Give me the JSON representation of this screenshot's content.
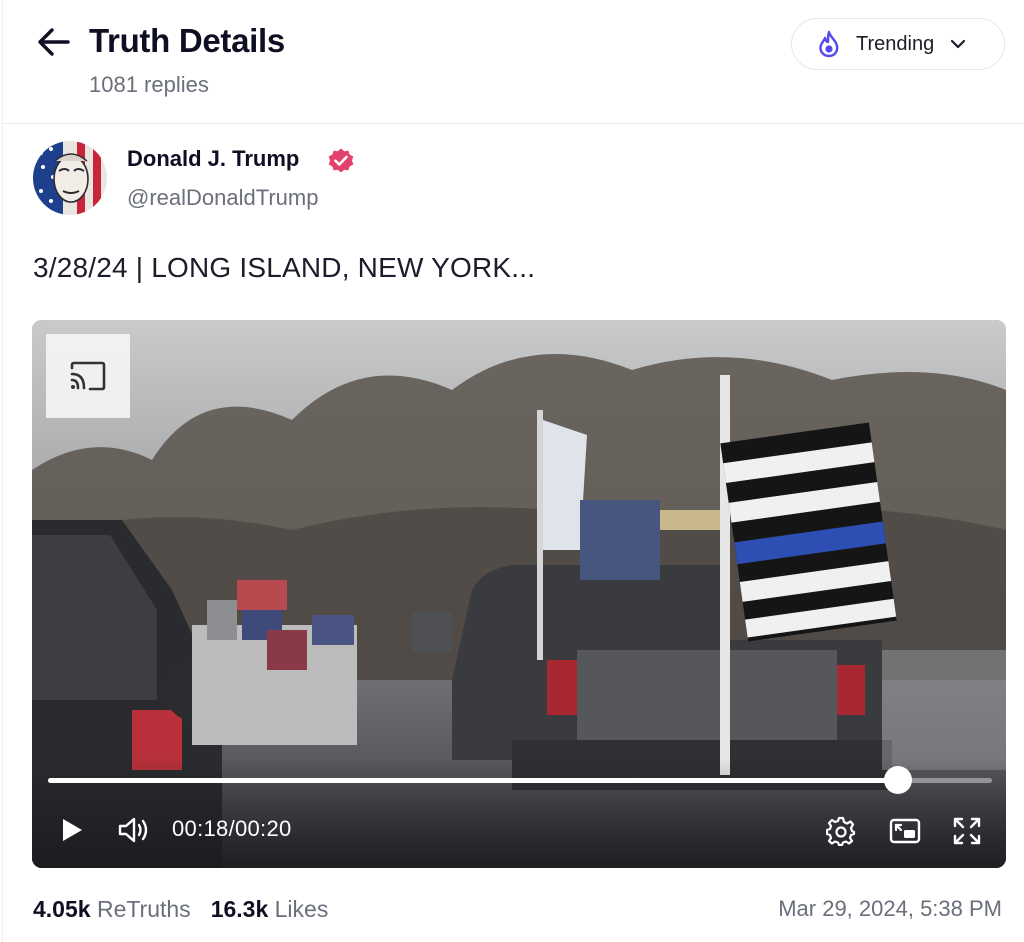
{
  "header": {
    "title": "Truth Details",
    "replies": "1081 replies",
    "sort": {
      "label": "Trending",
      "icon": "flame-icon"
    }
  },
  "author": {
    "name": "Donald J. Trump",
    "handle": "@realDonaldTrump",
    "verified": true,
    "badge_color": "#e2426c"
  },
  "post": {
    "text": "3/28/24 | LONG ISLAND, NEW YORK..."
  },
  "video": {
    "current_time": "00:18",
    "separator": "/",
    "duration": "00:20",
    "progress": 0.9
  },
  "stats": {
    "retruths_count": "4.05k",
    "retruths_label": "ReTruths",
    "likes_count": "16.3k",
    "likes_label": "Likes",
    "date": "Mar 29, 2024, 5:38 PM"
  },
  "colors": {
    "accent": "#5448ee",
    "text_primary": "#0f0f23",
    "text_secondary": "#6b6f7b"
  }
}
